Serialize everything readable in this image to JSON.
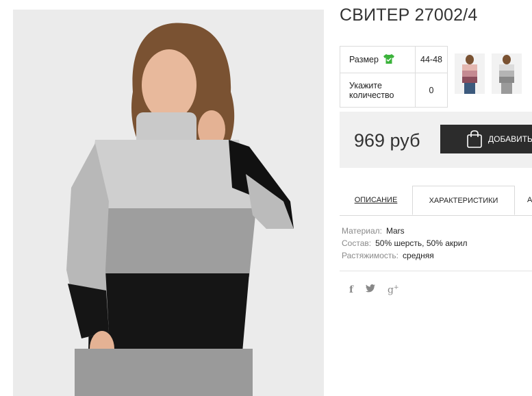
{
  "product": {
    "title": "СВИТЕР 27002/4"
  },
  "params": {
    "size_label": "Размер",
    "size_value": "44-48",
    "qty_label_line1": "Укажите",
    "qty_label_line2": "количество",
    "qty_value": "0"
  },
  "purchase": {
    "price": "969 руб",
    "add_button_label": "ДОБАВИТЬ"
  },
  "tabs": {
    "description": "ОПИСАНИЕ",
    "characteristics": "ХАРАКТЕРИСТИКИ",
    "more": "А"
  },
  "characteristics": [
    {
      "key": "Материал:",
      "value": "Mars"
    },
    {
      "key": "Состав:",
      "value": "50% шерсть, 50% акрил"
    },
    {
      "key": "Растяжимость:",
      "value": "средняя"
    }
  ],
  "social": {
    "facebook": "f",
    "twitter": "🐦",
    "google_plus": "g+"
  },
  "colors": {
    "size_icon": "#3bb33b",
    "button_bg": "#2c2c2c",
    "price_box_bg": "#f0f0f0"
  }
}
